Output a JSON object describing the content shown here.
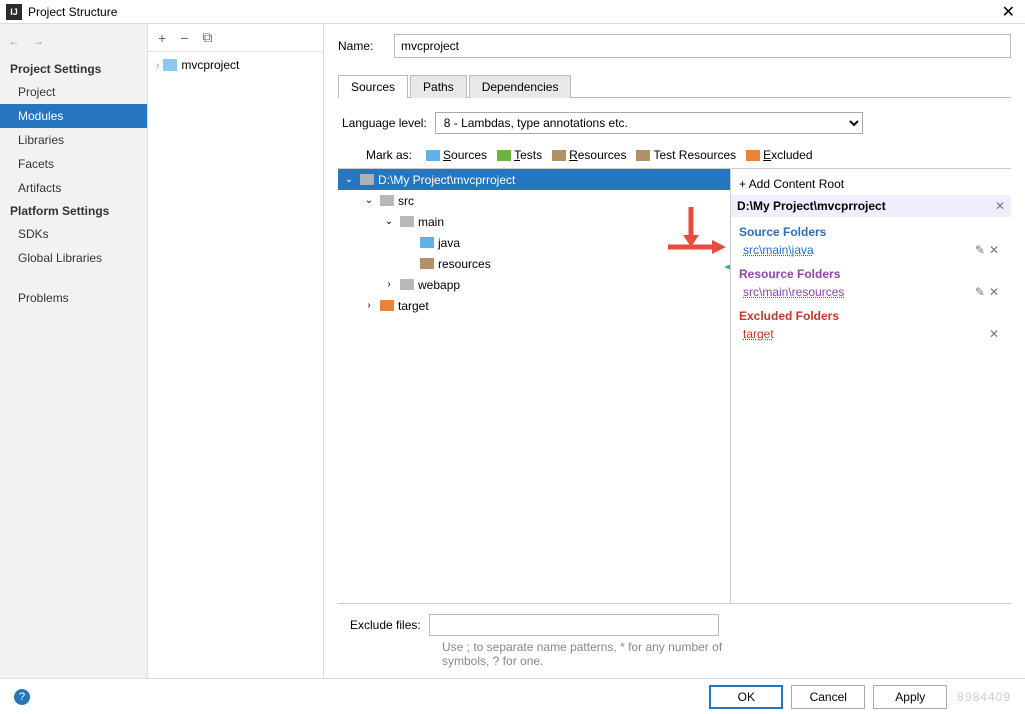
{
  "window": {
    "title": "Project Structure",
    "close_icon": "✕"
  },
  "nav": {
    "back": "←",
    "forward": "→"
  },
  "sidebar": {
    "section_project": "Project Settings",
    "section_platform": "Platform Settings",
    "items_project": [
      "Project",
      "Modules",
      "Libraries",
      "Facets",
      "Artifacts"
    ],
    "items_platform": [
      "SDKs",
      "Global Libraries"
    ],
    "problems": "Problems"
  },
  "module_toolbar": {
    "add": "+",
    "remove": "−",
    "copy": "⧉"
  },
  "module_tree": {
    "root": "mvcproject"
  },
  "name_field": {
    "label": "Name:",
    "value": "mvcproject"
  },
  "tabs": [
    "Sources",
    "Paths",
    "Dependencies"
  ],
  "lang": {
    "label": "Language level:",
    "selected": "8 - Lambdas, type annotations etc."
  },
  "mark": {
    "label": "Mark as:",
    "sources": "Sources",
    "tests": "Tests",
    "resources": "Resources",
    "test_resources": "Test Resources",
    "excluded": "Excluded"
  },
  "src_tree": {
    "root": "D:\\My Project\\mvcprroject",
    "src": "src",
    "main": "main",
    "java": "java",
    "resources": "resources",
    "webapp": "webapp",
    "target": "target"
  },
  "right": {
    "add_root": "+ Add Content Root",
    "root_path": "D:\\My Project\\mvcprroject",
    "source_head": "Source Folders",
    "source_item": "src\\main\\java",
    "resource_head": "Resource Folders",
    "resource_item": "src\\main\\resources",
    "excluded_head": "Excluded Folders",
    "excluded_item": "target",
    "edit": "✎",
    "del": "✕"
  },
  "exclude": {
    "label": "Exclude files:",
    "value": "",
    "hint": "Use ; to separate name patterns, * for any number of symbols, ? for one."
  },
  "buttons": {
    "ok": "OK",
    "cancel": "Cancel",
    "apply": "Apply"
  },
  "watermark": "8984409"
}
